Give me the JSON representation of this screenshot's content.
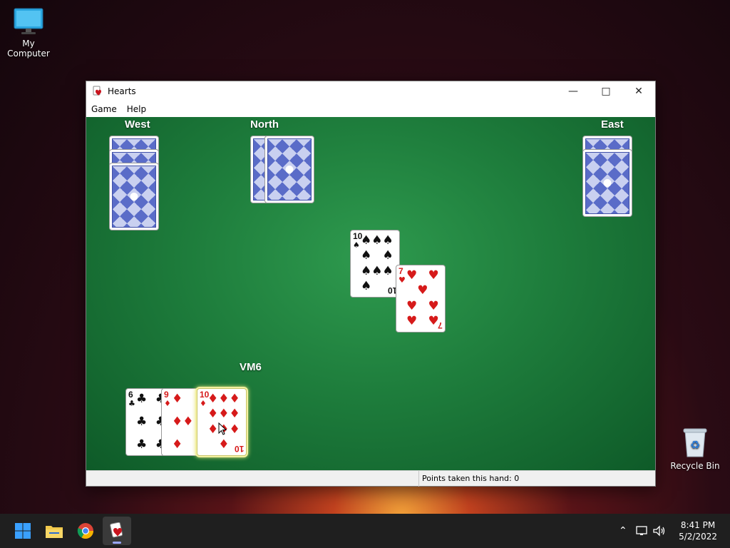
{
  "desktop": {
    "icons": [
      {
        "label": "My Computer",
        "icon": "monitor-icon"
      },
      {
        "label": "Recycle Bin",
        "icon": "recycle-bin-icon"
      }
    ]
  },
  "window": {
    "title": "Hearts",
    "menu": [
      "Game",
      "Help"
    ],
    "controls": [
      "minimize",
      "maximize",
      "close"
    ]
  },
  "game": {
    "players": {
      "west": "West",
      "north": "North",
      "east": "East",
      "south": "VM6"
    },
    "trick": [
      {
        "rank": "10",
        "suit": "♠",
        "color": "black"
      },
      {
        "rank": "7",
        "suit": "♥",
        "color": "red"
      }
    ],
    "hand": [
      {
        "rank": "6",
        "suit": "♣",
        "color": "black"
      },
      {
        "rank": "9",
        "suit": "♦",
        "color": "red"
      },
      {
        "rank": "10",
        "suit": "♦",
        "color": "red",
        "selected": true
      }
    ]
  },
  "status": {
    "points_text": "Points taken this hand: 0"
  },
  "taskbar": {
    "apps": [
      "start-icon",
      "file-explorer-icon",
      "chrome-icon",
      "hearts-icon"
    ],
    "time": "8:41 PM",
    "date": "5/2/2022"
  },
  "colors": {
    "felt": "#1e7d3c",
    "card_back": "#5a6cc8",
    "taskbar": "#1f1f1f"
  }
}
